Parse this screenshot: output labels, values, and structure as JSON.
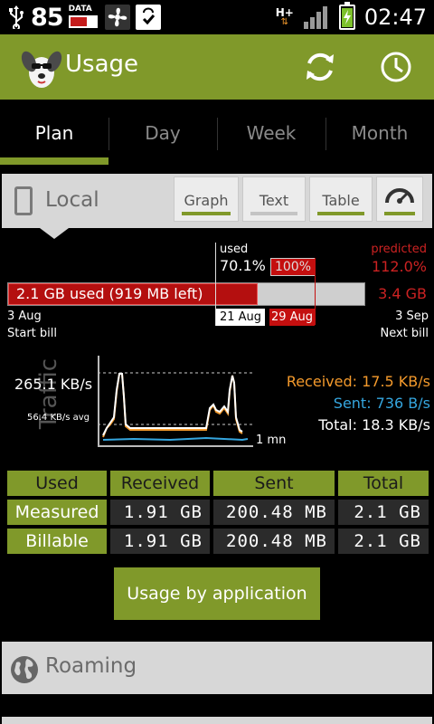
{
  "status_bar": {
    "notification_count": "85",
    "data_label": "DATA",
    "network_type": "H+",
    "time": "02:47",
    "icons": [
      "usb-icon",
      "data-usage-icon",
      "fan-icon",
      "shopping-bag-icon",
      "signal-icon",
      "battery-charging-icon"
    ]
  },
  "action_bar": {
    "title": "Usage",
    "actions": [
      "refresh-icon",
      "history-clock-icon"
    ]
  },
  "tabs": [
    "Plan",
    "Day",
    "Week",
    "Month"
  ],
  "active_tab": 0,
  "local": {
    "title": "Local",
    "views": [
      "Graph",
      "Text",
      "Table"
    ],
    "view_icon": "speedometer-icon",
    "active_views": [
      true,
      false,
      true,
      true
    ]
  },
  "plan": {
    "used_label": "used",
    "used_pct": "70.1%",
    "limit_pct": "100%",
    "predicted_label": "predicted",
    "predicted_pct": "112.0%",
    "bar_text": "2.1 GB used (919 MB left)",
    "used_fraction": 0.701,
    "predicted_gb": "3.4 GB",
    "start_date": "3 Aug",
    "start_label": "Start bill",
    "today_date": "21 Aug",
    "limit_date": "29 Aug",
    "end_date": "3 Sep",
    "end_label": "Next bill"
  },
  "traffic": {
    "title": "Traffic",
    "max_speed": "265.1 KB/s",
    "avg_speed": "56.4 KB/s avg",
    "time_span": "1 mn",
    "received": "Received: 17.5 KB/s",
    "sent": "Sent: 736 B/s",
    "total": "Total: 18.3 KB/s",
    "received_color": "#f49a2c",
    "sent_color": "#35a6df",
    "total_color": "#ffffff"
  },
  "table": {
    "headers": [
      "Used",
      "Received",
      "Sent",
      "Total"
    ],
    "rows": [
      {
        "label": "Measured",
        "received": "1.91 GB",
        "sent": "200.48 MB",
        "total": "2.1 GB"
      },
      {
        "label": "Billable",
        "received": "1.91 GB",
        "sent": "200.48 MB",
        "total": "2.1 GB"
      }
    ]
  },
  "usage_by_app_button": "Usage by application",
  "roaming": {
    "title": "Roaming"
  },
  "colors": {
    "accent": "#80992a",
    "over_limit": "#c40f0f",
    "predicted": "#cc2222"
  }
}
